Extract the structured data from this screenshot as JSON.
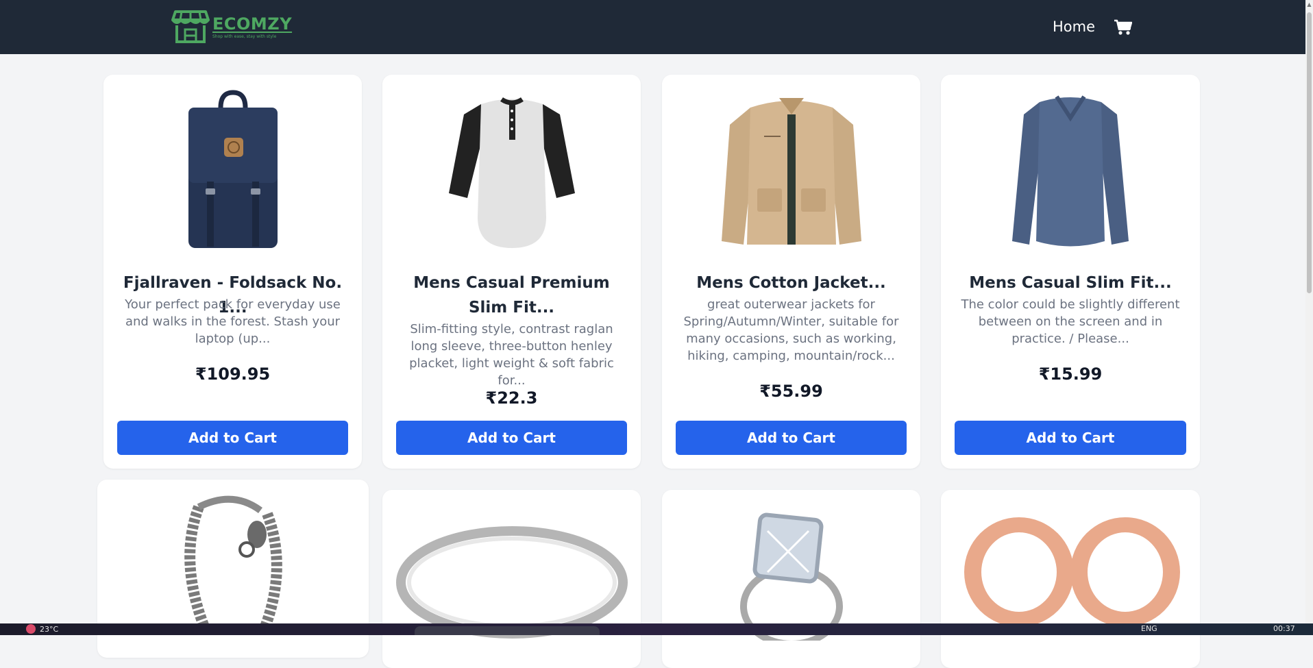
{
  "brand": {
    "name": "ECOMZY",
    "tagline": "Shop with ease, stay with style",
    "accent": "#4ea861"
  },
  "nav": {
    "home_label": "Home",
    "cart_icon": "shopping-cart-icon",
    "background": "#1f2937"
  },
  "colors": {
    "page_bg": "#f3f4f6",
    "button": "#2563eb",
    "title": "#1f2937",
    "description": "#6b7280"
  },
  "products": [
    {
      "title": "Fjallraven - Foldsack No. 1...",
      "description": "Your perfect pack for everyday use and walks in the forest. Stash your laptop (up...",
      "price": "₹109.95",
      "button_label": "Add to Cart",
      "image": "navy-backpack"
    },
    {
      "title": "Mens Casual Premium Slim Fit...",
      "description": "Slim-fitting style, contrast raglan long sleeve, three-button henley placket, light weight & soft fabric for...",
      "price": "₹22.3",
      "button_label": "Add to Cart",
      "image": "raglan-henley-shirt"
    },
    {
      "title": "Mens Cotton Jacket...",
      "description": "great outerwear jackets for Spring/Autumn/Winter, suitable for many occasions, such as working, hiking, camping, mountain/rock...",
      "price": "₹55.99",
      "button_label": "Add to Cart",
      "image": "khaki-cotton-jacket"
    },
    {
      "title": "Mens Casual Slim Fit...",
      "description": "The color could be slightly different between on the screen and in practice. / Please...",
      "price": "₹15.99",
      "button_label": "Add to Cart",
      "image": "blue-long-sleeve-tee"
    }
  ],
  "products_row2": [
    {
      "image": "dragon-chain-bracelet"
    },
    {
      "image": "silver-band-ring"
    },
    {
      "image": "diamond-halo-ring-set"
    },
    {
      "image": "rose-gold-tunnel-plugs"
    }
  ],
  "taskbar": {
    "weather": "23°C",
    "language": "ENG",
    "time": "00:37"
  }
}
